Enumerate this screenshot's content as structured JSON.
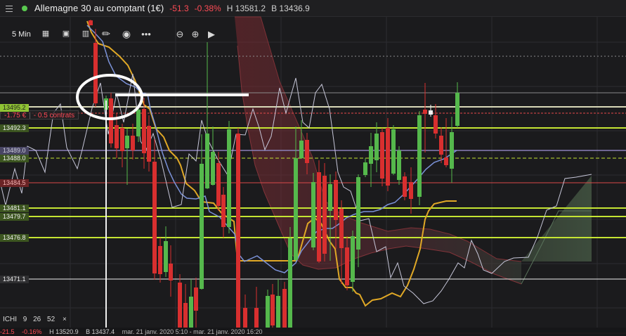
{
  "header": {
    "instrument_name": "Allemagne 30 au comptant (1€)",
    "change": "-51.3",
    "change_percent": "-0.38%",
    "high": "H 13581.2",
    "bid": "B 13436.9"
  },
  "toolbar": {
    "timeframe": "5 Min",
    "icons": [
      "grid-icon",
      "copy-icon",
      "bar-chart-icon",
      "pencil-icon",
      "eye-icon",
      "more-icon",
      "zoom-out-icon",
      "zoom-in-icon",
      "play-icon"
    ]
  },
  "position": {
    "pnl": "-1.75 €",
    "size": "- 0.5 contrats"
  },
  "price_levels": [
    {
      "label": "13495.2",
      "color": "#a8d43d"
    },
    {
      "label": "13492.3",
      "color": "#c5e533"
    },
    {
      "label": "13489.0",
      "color": "#8b83bc"
    },
    {
      "label": "13488.0",
      "color": "#c5e533"
    },
    {
      "label": "13484.5",
      "color": "#e13b3b"
    },
    {
      "label": "13481.1",
      "color": "#c5e533"
    },
    {
      "label": "13479.7",
      "color": "#c5e533"
    },
    {
      "label": "13476.8",
      "color": "#c5e533"
    },
    {
      "label": "13471.1",
      "color": "#f1f1f1"
    }
  ],
  "indicator": {
    "name": "ICHI",
    "values": [
      "9",
      "26",
      "52"
    ],
    "close": "×"
  },
  "bottom_info": {
    "change": "-21.5",
    "change_percent": "-0.16%",
    "high": "H 13520.9",
    "bid": "B 13437.4",
    "date_range": "mar. 21 janv. 2020 5:10 - mar. 21 janv. 2020 16:20"
  },
  "colors": {
    "background": "#1b1b1d",
    "bullish": "#55b84c",
    "bearish": "#d82f2f",
    "ichimoku_cloud": "#6f2d33",
    "kijun": "#e0a826",
    "tenkan": "#7c8fd6",
    "chikou": "#c6c6d8"
  }
}
